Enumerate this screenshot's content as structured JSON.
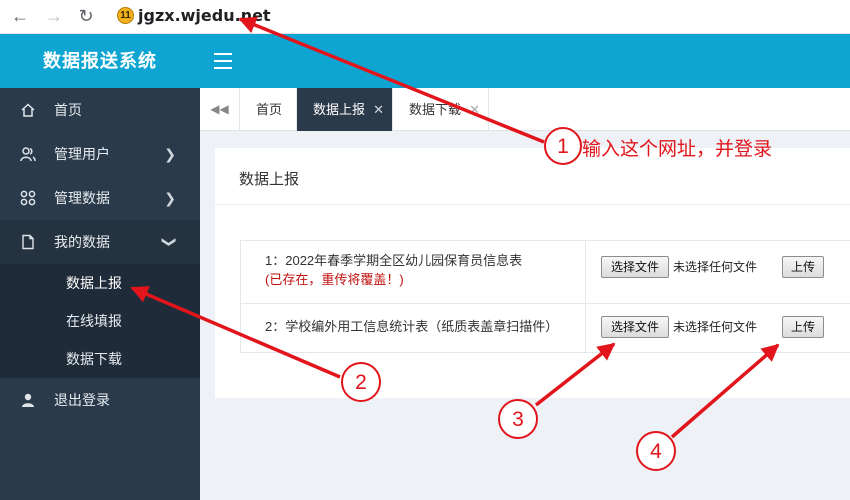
{
  "browser": {
    "url": "jgzx.wjedu.net",
    "badge": "11"
  },
  "header": {
    "title": "数据报送系统"
  },
  "sidebar": {
    "items": [
      {
        "label": "首页",
        "icon": "home-icon"
      },
      {
        "label": "管理用户",
        "icon": "users-icon"
      },
      {
        "label": "管理数据",
        "icon": "grid-icon"
      },
      {
        "label": "我的数据",
        "icon": "document-icon"
      },
      {
        "label": "退出登录",
        "icon": "user-icon"
      }
    ],
    "submenu": [
      "数据上报",
      "在线填报",
      "数据下载"
    ]
  },
  "tabs": [
    "首页",
    "数据上报",
    "数据下载"
  ],
  "panel": {
    "title": "数据上报",
    "rows": [
      {
        "label": "1：2022年春季学期全区幼儿园保育员信息表",
        "note": "(已存在，重传将覆盖！)"
      },
      {
        "label": "2：学校编外用工信息统计表（纸质表盖章扫描件）"
      }
    ],
    "choose_file": "选择文件",
    "no_file": "未选择任何文件",
    "upload": "上传"
  },
  "annotations": {
    "note": "输入这个网址，并登录",
    "markers": [
      "1",
      "2",
      "3",
      "4"
    ],
    "color": "#e1151b"
  }
}
